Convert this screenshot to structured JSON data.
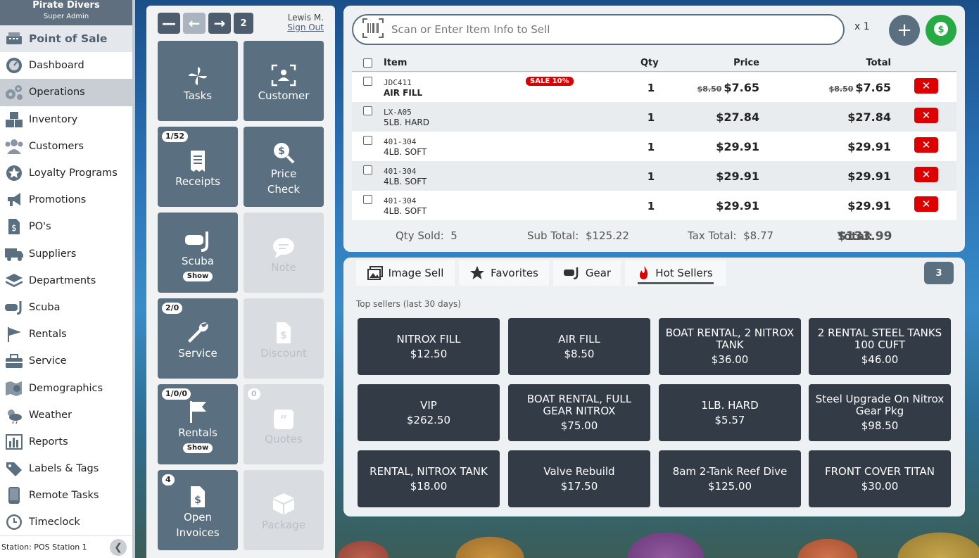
{
  "app": {
    "store_name": "Pirate Divers",
    "role": "Super Admin"
  },
  "sidebar": {
    "items": [
      {
        "label": "Point of Sale",
        "icon": "register-icon"
      },
      {
        "label": "Dashboard",
        "icon": "gauge-icon"
      },
      {
        "label": "Operations",
        "icon": "gears-icon"
      },
      {
        "label": "Inventory",
        "icon": "boxes-icon"
      },
      {
        "label": "Customers",
        "icon": "users-icon"
      },
      {
        "label": "Loyalty Programs",
        "icon": "star-badge-icon"
      },
      {
        "label": "Promotions",
        "icon": "megaphone-icon"
      },
      {
        "label": "PO's",
        "icon": "dollar-document-icon"
      },
      {
        "label": "Suppliers",
        "icon": "truck-icon"
      },
      {
        "label": "Departments",
        "icon": "layers-icon"
      },
      {
        "label": "Scuba",
        "icon": "mask-snorkel-icon"
      },
      {
        "label": "Rentals",
        "icon": "flag-icon"
      },
      {
        "label": "Service",
        "icon": "toolbox-icon"
      },
      {
        "label": "Demographics",
        "icon": "map-pin-icon"
      },
      {
        "label": "Weather",
        "icon": "cloud-sun-icon"
      },
      {
        "label": "Reports",
        "icon": "bar-chart-icon"
      },
      {
        "label": "Labels & Tags",
        "icon": "tags-icon"
      },
      {
        "label": "Remote Tasks",
        "icon": "tablet-icon"
      },
      {
        "label": "Timeclock",
        "icon": "clock-icon"
      }
    ],
    "station": "Station: POS Station 1"
  },
  "tools": {
    "cart_count": "2",
    "user_name": "Lewis M.",
    "sign_out": "Sign Out",
    "tiles": [
      {
        "label": "Tasks",
        "badge": "",
        "show": ""
      },
      {
        "label": "Customer",
        "badge": "",
        "show": ""
      },
      {
        "label": "Receipts",
        "badge": "1/52",
        "show": ""
      },
      {
        "label": "Price\nCheck",
        "badge": "",
        "show": ""
      },
      {
        "label": "Scuba",
        "badge": "",
        "show": "Show"
      },
      {
        "label": "Note",
        "badge": "",
        "show": ""
      },
      {
        "label": "Service",
        "badge": "2/0",
        "show": ""
      },
      {
        "label": "Discount",
        "badge": "",
        "show": ""
      },
      {
        "label": "Rentals",
        "badge": "1/0/0",
        "show": "Show"
      },
      {
        "label": "Quotes",
        "badge": "0",
        "show": ""
      },
      {
        "label": "Open\nInvoices",
        "badge": "4",
        "show": ""
      },
      {
        "label": "Package",
        "badge": "",
        "show": ""
      }
    ]
  },
  "scan": {
    "placeholder": "Scan or Enter Item Info to Sell",
    "qty_multiplier": "x 1"
  },
  "cart": {
    "headers": {
      "item": "Item",
      "qty": "Qty",
      "price": "Price",
      "total": "Total"
    },
    "rows": [
      {
        "sku": "JDC411",
        "name": "AIR FILL",
        "badge": "SALE 10%",
        "qty": "1",
        "orig_price": "$8.50",
        "price": "$7.65",
        "orig_total": "$8.50",
        "total": "$7.65"
      },
      {
        "sku": "LX-A05",
        "name": "5LB. HARD",
        "badge": "",
        "qty": "1",
        "orig_price": "",
        "price": "$27.84",
        "orig_total": "",
        "total": "$27.84"
      },
      {
        "sku": "401-304",
        "name": "4LB. SOFT",
        "badge": "",
        "qty": "1",
        "orig_price": "",
        "price": "$29.91",
        "orig_total": "",
        "total": "$29.91"
      },
      {
        "sku": "401-304",
        "name": "4LB. SOFT",
        "badge": "",
        "qty": "1",
        "orig_price": "",
        "price": "$29.91",
        "orig_total": "",
        "total": "$29.91"
      },
      {
        "sku": "401-304",
        "name": "4LB. SOFT",
        "badge": "",
        "qty": "1",
        "orig_price": "",
        "price": "$29.91",
        "orig_total": "",
        "total": "$29.91"
      }
    ],
    "qty_sold": "Qty Sold:  5",
    "sub_total": "Sub Total:  $125.22",
    "tax_total": "Tax Total:  $8.77",
    "total_label": "Total:",
    "total_value": "$133.99"
  },
  "products": {
    "tabs": [
      "Image Sell",
      "Favorites",
      "Gear",
      "Hot Sellers"
    ],
    "active_tab": "Hot Sellers",
    "page_button": "3",
    "section_label": "Top sellers (last 30 days)",
    "items": [
      {
        "name": "NITROX FILL",
        "price": "$12.50"
      },
      {
        "name": "AIR FILL",
        "price": "$8.50"
      },
      {
        "name": "BOAT RENTAL, 2 NITROX TANK",
        "price": "$36.00"
      },
      {
        "name": "2 RENTAL STEEL TANKS 100 CUFT",
        "price": "$46.00"
      },
      {
        "name": "VIP",
        "price": "$262.50"
      },
      {
        "name": "BOAT RENTAL, FULL GEAR NITROX",
        "price": "$75.00"
      },
      {
        "name": "1LB. HARD",
        "price": "$5.57"
      },
      {
        "name": "Steel Upgrade On Nitrox Gear Pkg",
        "price": "$98.50"
      },
      {
        "name": "RENTAL, NITROX TANK",
        "price": "$18.00"
      },
      {
        "name": "Valve Rebuild",
        "price": "$17.50"
      },
      {
        "name": "8am 2-Tank Reef Dive",
        "price": "$125.00"
      },
      {
        "name": "FRONT COVER TITAN",
        "price": "$30.00"
      }
    ]
  },
  "colors": {
    "accent": "#5a6f80",
    "pay": "#27a944",
    "danger": "#dd0000",
    "product_tile": "#333c46"
  }
}
